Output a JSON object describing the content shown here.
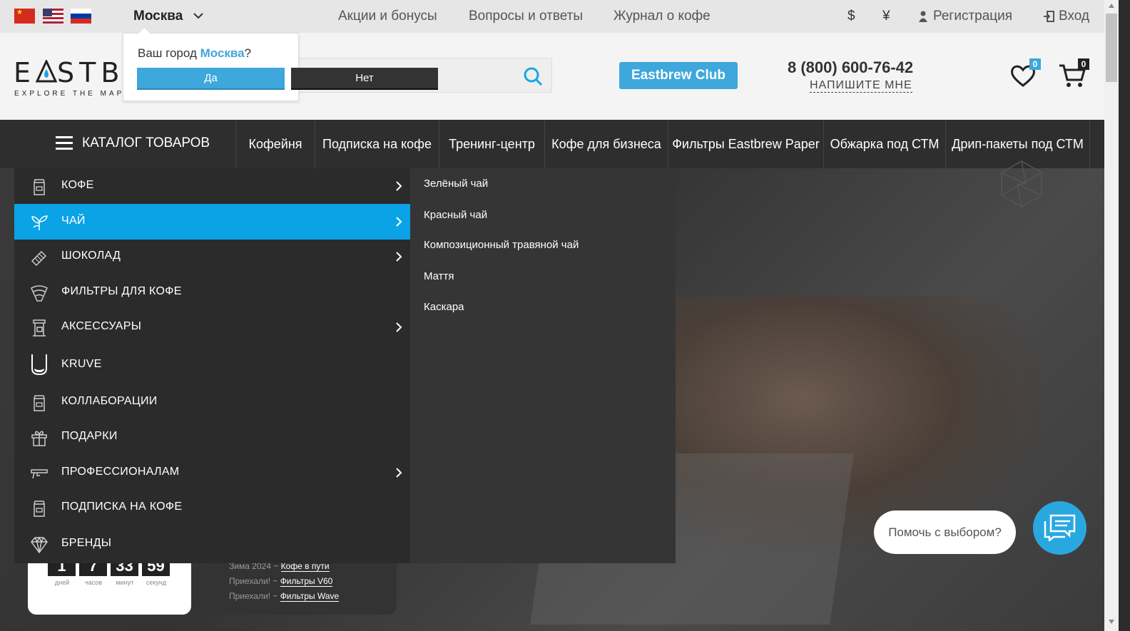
{
  "topbar": {
    "city": "Москва",
    "nav": [
      "Акции и бонусы",
      "Вопросы и ответы",
      "Журнал о кофе"
    ],
    "currency_usd": "$",
    "currency_cny": "¥",
    "register": "Регистрация",
    "login": "Вход"
  },
  "city_popup": {
    "question_prefix": "Ваш город",
    "city": "Москва",
    "question_suffix": "?",
    "yes": "Да",
    "no": "Нет"
  },
  "header": {
    "logo_text": "EASTB",
    "logo_tagline": "EXPLORE THE MAP",
    "club_button": "Eastbrew Club",
    "phone": "8 (800) 600-76-42",
    "write_us": "НАПИШИТЕ МНЕ",
    "wishlist_count": "0",
    "cart_count": "0"
  },
  "navbar": {
    "catalog": "КАТАЛОГ ТОВАРОВ",
    "items": [
      "Кофейня",
      "Подписка на кофе",
      "Тренинг-центр",
      "Кофе для бизнеса",
      "Фильтры Eastbrew Paper",
      "Обжарка под СТМ",
      "Дрип-пакеты под СТМ"
    ]
  },
  "catalog_menu": {
    "items": [
      {
        "label": "КОФЕ",
        "icon": "coffee-bag-icon",
        "has_sub": true
      },
      {
        "label": "ЧАЙ",
        "icon": "tea-leaf-icon",
        "has_sub": true,
        "active": true
      },
      {
        "label": "ШОКОЛАД",
        "icon": "chocolate-icon",
        "has_sub": true
      },
      {
        "label": "ФИЛЬТРЫ ДЛЯ КОФЕ",
        "icon": "coffee-filter-icon",
        "has_sub": false
      },
      {
        "label": "АКСЕССУАРЫ",
        "icon": "coffee-machine-icon",
        "has_sub": true
      },
      {
        "label": "KRUVE",
        "icon": "kruve-cup-icon",
        "has_sub": false
      },
      {
        "label": "КОЛЛАБОРАЦИИ",
        "icon": "coffee-bag-icon",
        "has_sub": false
      },
      {
        "label": "ПОДАРКИ",
        "icon": "gift-icon",
        "has_sub": false
      },
      {
        "label": "ПРОФЕССИОНАЛАМ",
        "icon": "barista-tool-icon",
        "has_sub": true
      },
      {
        "label": "ПОДПИСКА НА КОФЕ",
        "icon": "coffee-bag-icon",
        "has_sub": false
      },
      {
        "label": "БРЕНДЫ",
        "icon": "diamond-icon",
        "has_sub": false
      }
    ],
    "submenu": [
      "Зелёный чай",
      "Красный чай",
      "Композиционный травяной чай",
      "Маття",
      "Каскара"
    ]
  },
  "countdown": {
    "values": [
      "1",
      "7",
      "33",
      "59"
    ],
    "labels": [
      "дней",
      "часов",
      "минут",
      "секунд"
    ]
  },
  "news": [
    {
      "prefix": "Зима 2024 ~",
      "link": "Кофе в пути"
    },
    {
      "prefix": "Приехали! ~",
      "link": "Фильтры V60"
    },
    {
      "prefix": "Приехали! ~",
      "link": "Фильтры Wave"
    }
  ],
  "chat": {
    "help_text": "Помочь с выбором?"
  },
  "colors": {
    "accent": "#0aa3e6",
    "club_button": "#3ea7dc",
    "nav_bg": "#2e2e2e",
    "menu_bg": "#2b2b2b"
  }
}
